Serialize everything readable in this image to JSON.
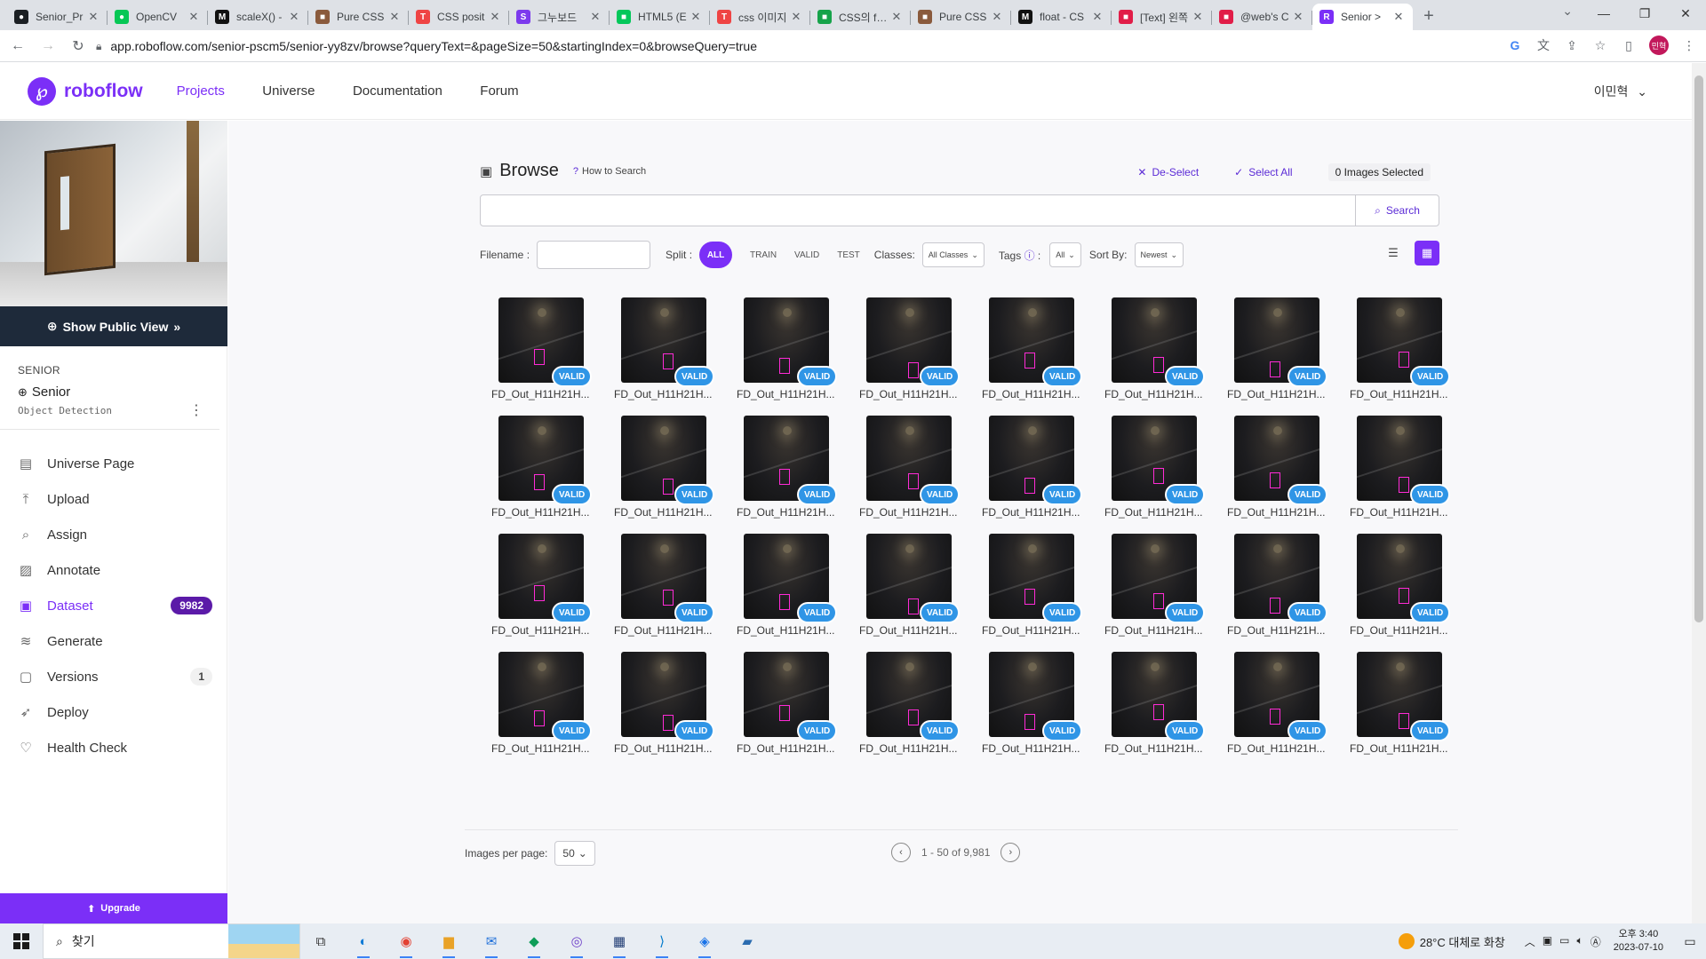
{
  "browser": {
    "tabs": [
      {
        "title": "Senior_Pr",
        "icon": "github-icon",
        "color": "#1b1f23",
        "glyph": "●"
      },
      {
        "title": "OpenCV",
        "icon": "line-icon",
        "color": "#06c755",
        "glyph": "●"
      },
      {
        "title": "scaleX() -",
        "icon": "mdn-icon",
        "color": "#111111",
        "glyph": "M"
      },
      {
        "title": "Pure CSS",
        "icon": "site-icon",
        "color": "#8a5a3c",
        "glyph": "■"
      },
      {
        "title": "CSS posit",
        "icon": "tistory-icon",
        "color": "#ef4444",
        "glyph": "T"
      },
      {
        "title": "그누보드",
        "icon": "s-icon",
        "color": "#7c3aed",
        "glyph": "S"
      },
      {
        "title": "HTML5 (E",
        "icon": "naver-icon",
        "color": "#03c75a",
        "glyph": "■"
      },
      {
        "title": "css 이미지",
        "icon": "tistory-icon",
        "color": "#ef4444",
        "glyph": "T"
      },
      {
        "title": "CSS의 fixe",
        "icon": "doc-icon",
        "color": "#16a34a",
        "glyph": "■"
      },
      {
        "title": "Pure CSS",
        "icon": "site-icon",
        "color": "#8a5a3c",
        "glyph": "■"
      },
      {
        "title": "float - CS",
        "icon": "mdn-icon",
        "color": "#111111",
        "glyph": "M"
      },
      {
        "title": "[Text] 왼쪽",
        "icon": "page-icon",
        "color": "#e11d48",
        "glyph": "■"
      },
      {
        "title": "@web's C",
        "icon": "page-icon",
        "color": "#e11d48",
        "glyph": "■"
      },
      {
        "title": "Senior >",
        "icon": "roboflow-icon",
        "color": "#7b2ff7",
        "glyph": "R"
      }
    ],
    "url": "app.roboflow.com/senior-pscm5/senior-yy8zv/browse?queryText=&pageSize=50&startingIndex=0&browseQuery=true",
    "profile_initials": "민혁"
  },
  "header": {
    "logo_text": "roboflow",
    "nav": [
      "Projects",
      "Universe",
      "Documentation",
      "Forum"
    ],
    "user_name": "이민혁"
  },
  "sidebar": {
    "public_view_label": "Show Public View",
    "workspace": "SENIOR",
    "project_name": "Senior",
    "project_type": "Object Detection",
    "items": [
      {
        "label": "Universe Page",
        "icon": "universe-page-icon",
        "glyph": "▤"
      },
      {
        "label": "Upload",
        "icon": "upload-icon",
        "glyph": "⤒"
      },
      {
        "label": "Assign",
        "icon": "assign-icon",
        "glyph": "⌕"
      },
      {
        "label": "Annotate",
        "icon": "annotate-icon",
        "glyph": "▨"
      },
      {
        "label": "Dataset",
        "icon": "dataset-icon",
        "glyph": "▣",
        "badge": "9982"
      },
      {
        "label": "Generate",
        "icon": "generate-icon",
        "glyph": "≋"
      },
      {
        "label": "Versions",
        "icon": "versions-icon",
        "glyph": "▢",
        "badge": "1"
      },
      {
        "label": "Deploy",
        "icon": "deploy-icon",
        "glyph": "➶"
      },
      {
        "label": "Health Check",
        "icon": "health-check-icon",
        "glyph": "♡"
      }
    ],
    "upgrade_label": "Upgrade"
  },
  "browse": {
    "title": "Browse",
    "how_to_search": "How to Search",
    "deselect": "De-Select",
    "select_all": "Select All",
    "selected_count": "0 Images Selected",
    "search_placeholder": "",
    "search_button": "Search",
    "filename_label": "Filename :",
    "filename_value": "",
    "split_label": "Split :",
    "split_options": [
      "ALL",
      "TRAIN",
      "VALID",
      "TEST"
    ],
    "classes_label": "Classes:",
    "classes_value": "All Classes",
    "tags_label": "Tags",
    "tags_value": "All",
    "sort_label": "Sort By:",
    "sort_value": "Newest"
  },
  "images": [
    "FD_Out_H11H21H...",
    "FD_Out_H11H21H...",
    "FD_Out_H11H21H...",
    "FD_Out_H11H21H...",
    "FD_Out_H11H21H...",
    "FD_Out_H11H21H...",
    "FD_Out_H11H21H...",
    "FD_Out_H11H21H...",
    "FD_Out_H11H21H...",
    "FD_Out_H11H21H...",
    "FD_Out_H11H21H...",
    "FD_Out_H11H21H...",
    "FD_Out_H11H21H...",
    "FD_Out_H11H21H...",
    "FD_Out_H11H21H...",
    "FD_Out_H11H21H...",
    "FD_Out_H11H21H...",
    "FD_Out_H11H21H...",
    "FD_Out_H11H21H...",
    "FD_Out_H11H21H...",
    "FD_Out_H11H21H...",
    "FD_Out_H11H21H...",
    "FD_Out_H11H21H...",
    "FD_Out_H11H21H...",
    "FD_Out_H11H21H...",
    "FD_Out_H11H21H...",
    "FD_Out_H11H21H...",
    "FD_Out_H11H21H...",
    "FD_Out_H11H21H...",
    "FD_Out_H11H21H...",
    "FD_Out_H11H21H...",
    "FD_Out_H11H21H..."
  ],
  "image_badge": "VALID",
  "pagination": {
    "per_page_label": "Images per page:",
    "per_page_value": "50",
    "range_text": "1 - 50 of 9,981"
  },
  "taskbar": {
    "search_text": "찾기",
    "weather": "28°C 대체로 화창",
    "time": "오후 3:40",
    "date": "2023-07-10",
    "apps": [
      {
        "icon": "task-view-icon",
        "glyph": "⧉",
        "color": "#333333"
      },
      {
        "icon": "edge-icon",
        "glyph": "◐",
        "color": "#0f7bd6"
      },
      {
        "icon": "chrome-icon",
        "glyph": "◉",
        "color": "#e34133"
      },
      {
        "icon": "file-explorer-icon",
        "glyph": "▆",
        "color": "#e9a227"
      },
      {
        "icon": "mail-icon",
        "glyph": "✉",
        "color": "#1e6fd9"
      },
      {
        "icon": "app-green-icon",
        "glyph": "◆",
        "color": "#0f9d58"
      },
      {
        "icon": "github-desktop-icon",
        "glyph": "◎",
        "color": "#6e40c9"
      },
      {
        "icon": "app-network-icon",
        "glyph": "▦",
        "color": "#1f3b73"
      },
      {
        "icon": "vscode-icon",
        "glyph": "⟩",
        "color": "#007acc"
      },
      {
        "icon": "app-blue-icon",
        "glyph": "◈",
        "color": "#1a73e8"
      },
      {
        "icon": "app-note-icon",
        "glyph": "▰",
        "color": "#2b6cb0"
      }
    ]
  }
}
